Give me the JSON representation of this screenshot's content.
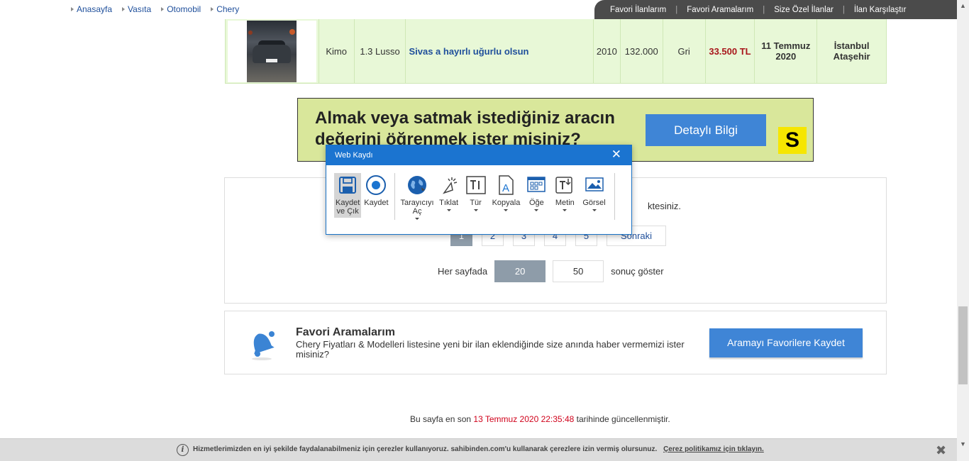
{
  "breadcrumb": [
    "Anasayfa",
    "Vasıta",
    "Otomobil",
    "Chery"
  ],
  "quicklinks": [
    "Favori İlanlarım",
    "Favori Aramalarım",
    "Size Özel İlanlar",
    "İlan Karşılaştır"
  ],
  "listing": {
    "brand": "Kimo",
    "model": "1.3 Lusso",
    "title": "Sivas a hayırlı uğurlu olsun",
    "year": "2010",
    "km": "132.000",
    "color": "Gri",
    "price": "33.500 TL",
    "date_line1": "11 Temmuz",
    "date_line2": "2020",
    "location_line1": "İstanbul",
    "location_line2": "Ataşehir"
  },
  "ad": {
    "headline": "Almak veya satmak istediğiniz aracın değerini öğrenmek ister misiniz?",
    "button": "Detaylı Bilgi",
    "logo": "S"
  },
  "results": {
    "found_text_suffix": "ktesiniz.",
    "pages": [
      "1",
      "2",
      "3",
      "4",
      "5"
    ],
    "active_page": "1",
    "next_label": "Sonraki",
    "per_page_label": "Her sayfada",
    "per_page_options": [
      "20",
      "50"
    ],
    "per_page_active": "20",
    "per_page_suffix": "sonuç göster"
  },
  "favorites": {
    "title": "Favori Aramalarım",
    "description": "Chery Fiyatları & Modelleri listesine yeni bir ilan eklendiğinde size anında haber vermemizi ister misiniz?",
    "button": "Aramayı Favorilere Kaydet"
  },
  "update": {
    "prefix": "Bu sayfa en son",
    "timestamp": "13 Temmuz 2020 22:35:48",
    "suffix": "tarihinde güncellenmiştir."
  },
  "cookie": {
    "text": "Hizmetlerimizden en iyi şekilde faydalanabilmeniz için çerezler kullanıyoruz. sahibinden.com'u kullanarak çerezlere izin vermiş olursunuz.",
    "link": "Çerez politikamız için tıklayın.",
    "close": "✖"
  },
  "dialog": {
    "title": "Web Kaydı",
    "close": "✕",
    "tools": [
      {
        "line1": "Kaydet",
        "line2": "ve Çık",
        "icon": "save-icon"
      },
      {
        "line1": "Kaydet",
        "line2": "",
        "icon": "record-icon"
      },
      {
        "line1": "Tarayıcıyı",
        "line2": "Aç",
        "icon": "globe-icon"
      },
      {
        "line1": "Tıklat",
        "line2": "",
        "icon": "click-icon"
      },
      {
        "line1": "Tür",
        "line2": "",
        "icon": "type-icon"
      },
      {
        "line1": "Kopyala",
        "line2": "",
        "icon": "copy-icon"
      },
      {
        "line1": "Öğe",
        "line2": "",
        "icon": "element-icon"
      },
      {
        "line1": "Metin",
        "line2": "",
        "icon": "text-icon"
      },
      {
        "line1": "Görsel",
        "line2": "",
        "icon": "image-icon"
      }
    ]
  },
  "colors": {
    "accent_blue": "#3f85d6",
    "dialog_blue": "#1b74d0",
    "listing_row_bg": "#e8f8d7",
    "price_red": "#a8161b",
    "timestamp_red": "#d0021b",
    "ad_bg": "#d9e79b",
    "logo_yellow": "#f6e600"
  }
}
